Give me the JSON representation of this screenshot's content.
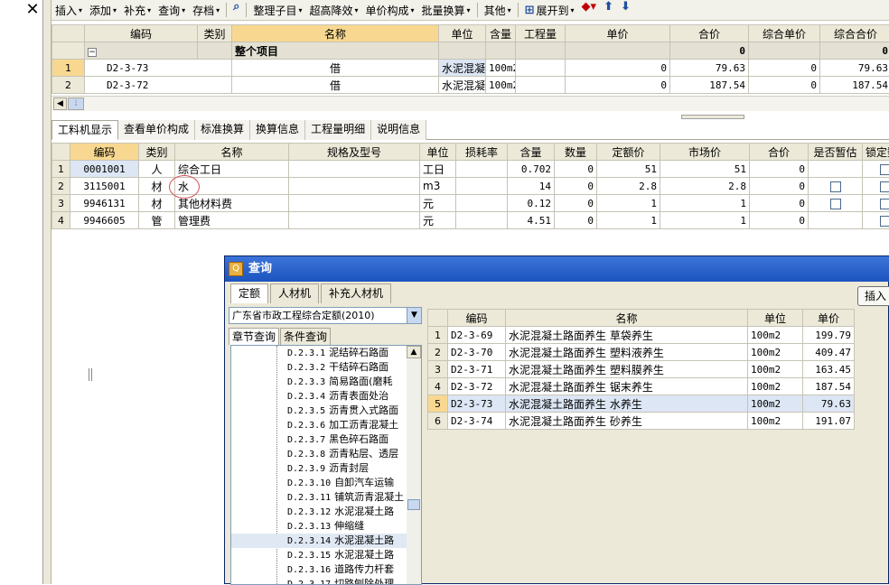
{
  "close_glyph": "✕",
  "toolbar": {
    "items": [
      "插入",
      "添加",
      "补充",
      "查询",
      "存档",
      "整理子目",
      "超高降效",
      "单价构成",
      "批量换算",
      "其他",
      "展开到"
    ],
    "has_caret": [
      true,
      true,
      true,
      true,
      true,
      true,
      true,
      true,
      true,
      true,
      true
    ],
    "icons": {
      "binoculars": "binoculars-icon",
      "expand": "expand-tree-icon",
      "fill": "fill-color-icon",
      "up": "arrow-up-icon",
      "down": "arrow-down-icon"
    }
  },
  "grid1": {
    "headers": [
      "编码",
      "类别",
      "名称",
      "单位",
      "含量",
      "工程量",
      "单价",
      "合价",
      "综合单价",
      "综合合价"
    ],
    "group_row": {
      "toggle": "−",
      "name": "整个项目",
      "hejia": "0",
      "zonghe_hejia": "0"
    },
    "rows": [
      {
        "no": "1",
        "code": "D2-3-73",
        "type": "借",
        "name": "水泥混凝土路面养生 水养生",
        "unit": "100m2",
        "content": "",
        "qty": "0",
        "price": "79.63",
        "total": "0",
        "comp_price": "79.63",
        "comp_total": "0"
      },
      {
        "no": "2",
        "code": "D2-3-72",
        "type": "借",
        "name": "水泥混凝土路面养生 锯末养生",
        "unit": "100m2",
        "content": "",
        "qty": "0",
        "price": "187.54",
        "total": "0",
        "comp_price": "187.54",
        "comp_total": "0"
      }
    ]
  },
  "tabs1": [
    "工料机显示",
    "查看单价构成",
    "标准换算",
    "换算信息",
    "工程量明细",
    "说明信息"
  ],
  "grid2": {
    "headers": [
      "编码",
      "类别",
      "名称",
      "规格及型号",
      "单位",
      "损耗率",
      "含量",
      "数量",
      "定额价",
      "市场价",
      "合价",
      "是否暂估",
      "锁定数量"
    ],
    "rows": [
      {
        "no": "1",
        "code": "0001001",
        "type": "人",
        "name": "综合工日",
        "spec": "",
        "unit": "工日",
        "loss": "",
        "content": "0.702",
        "qty": "0",
        "quota": "51",
        "market": "51",
        "total": "0",
        "est": false,
        "lock": true
      },
      {
        "no": "2",
        "code": "3115001",
        "type": "材",
        "name": "水",
        "spec": "",
        "unit": "m3",
        "loss": "",
        "content": "14",
        "qty": "0",
        "quota": "2.8",
        "market": "2.8",
        "total": "0",
        "est": true,
        "lock": true
      },
      {
        "no": "3",
        "code": "9946131",
        "type": "材",
        "name": "其他材料费",
        "spec": "",
        "unit": "元",
        "loss": "",
        "content": "0.12",
        "qty": "0",
        "quota": "1",
        "market": "1",
        "total": "0",
        "est": true,
        "lock": true
      },
      {
        "no": "4",
        "code": "9946605",
        "type": "管",
        "name": "管理费",
        "spec": "",
        "unit": "元",
        "loss": "",
        "content": "4.51",
        "qty": "0",
        "quota": "1",
        "market": "1",
        "total": "0",
        "est": false,
        "lock": true
      }
    ]
  },
  "query_dialog": {
    "title": "查询",
    "tabs": [
      "定额",
      "人材机",
      "补充人材机"
    ],
    "insert_label": "插入",
    "select_value": "广东省市政工程综合定额(2010)",
    "subtabs": [
      "章节查询",
      "条件查询"
    ],
    "tree": [
      {
        "code": "D.2.3.1",
        "name": "泥结碎石路面"
      },
      {
        "code": "D.2.3.2",
        "name": "干结碎石路面"
      },
      {
        "code": "D.2.3.3",
        "name": "简易路面(磨耗"
      },
      {
        "code": "D.2.3.4",
        "name": "沥青表面处治"
      },
      {
        "code": "D.2.3.5",
        "name": "沥青贯入式路面"
      },
      {
        "code": "D.2.3.6",
        "name": "加工沥青混凝土"
      },
      {
        "code": "D.2.3.7",
        "name": "黑色碎石路面"
      },
      {
        "code": "D.2.3.8",
        "name": "沥青粘层、透层"
      },
      {
        "code": "D.2.3.9",
        "name": "沥青封层"
      },
      {
        "code": "D.2.3.10",
        "name": "自卸汽车运输"
      },
      {
        "code": "D.2.3.11",
        "name": "铺筑沥青混凝土"
      },
      {
        "code": "D.2.3.12",
        "name": "水泥混凝土路"
      },
      {
        "code": "D.2.3.13",
        "name": "伸缩缝"
      },
      {
        "code": "D.2.3.14",
        "name": "水泥混凝土路"
      },
      {
        "code": "D.2.3.15",
        "name": "水泥混凝土路"
      },
      {
        "code": "D.2.3.16",
        "name": "道路传力杆套"
      },
      {
        "code": "D.2.3.17",
        "name": "切路刨除处理"
      }
    ],
    "tree_selected": 13,
    "headers": [
      "编码",
      "名称",
      "单位",
      "单价"
    ],
    "rows": [
      {
        "no": "1",
        "code": "D2-3-69",
        "name": "水泥混凝土路面养生 草袋养生",
        "unit": "100m2",
        "price": "199.79"
      },
      {
        "no": "2",
        "code": "D2-3-70",
        "name": "水泥混凝土路面养生 塑料液养生",
        "unit": "100m2",
        "price": "409.47"
      },
      {
        "no": "3",
        "code": "D2-3-71",
        "name": "水泥混凝土路面养生 塑料膜养生",
        "unit": "100m2",
        "price": "163.45"
      },
      {
        "no": "4",
        "code": "D2-3-72",
        "name": "水泥混凝土路面养生 锯末养生",
        "unit": "100m2",
        "price": "187.54"
      },
      {
        "no": "5",
        "code": "D2-3-73",
        "name": "水泥混凝土路面养生 水养生",
        "unit": "100m2",
        "price": "79.63"
      },
      {
        "no": "6",
        "code": "D2-3-74",
        "name": "水泥混凝土路面养生 砂养生",
        "unit": "100m2",
        "price": "191.07"
      }
    ],
    "selected_row": 4
  }
}
